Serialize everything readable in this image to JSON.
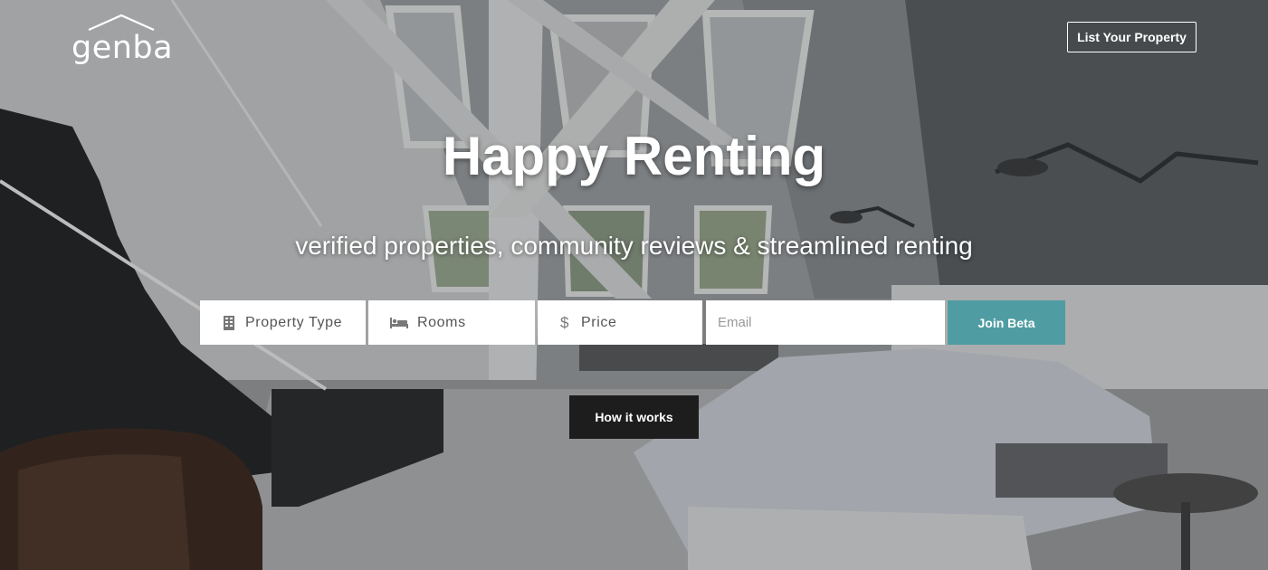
{
  "brand": {
    "name": "genba"
  },
  "header": {
    "list_property_label": "List Your Property"
  },
  "hero": {
    "title": "Happy Renting",
    "subtitle": "verified properties, community reviews & streamlined renting"
  },
  "search": {
    "property_type_label": "Property Type",
    "rooms_label": "Rooms",
    "price_label": "Price",
    "email_placeholder": "Email",
    "join_label": "Join Beta"
  },
  "cta": {
    "how_it_works_label": "How it works"
  },
  "colors": {
    "accent": "#4f9da3",
    "dark_button": "#1d1d1d"
  },
  "icons": {
    "property_type": "building-icon",
    "rooms": "bed-icon",
    "price": "dollar-icon"
  }
}
